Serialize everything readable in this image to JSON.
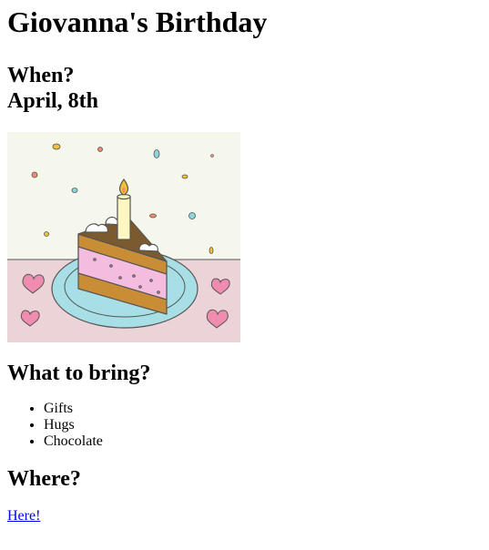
{
  "page": {
    "title": "Giovanna's Birthday",
    "when_heading": "When?",
    "when_date": "April, 8th",
    "image": {
      "subject": "birthday-cake-slice-icon",
      "colors": {
        "background": "#f5f6ec",
        "table": "#ecd3d8",
        "plate": "#a8dfe6",
        "cake_layer": "#c88d35",
        "frosting": "#f4bde0",
        "chocolate_top": "#7a5a2e",
        "candle": "#fdf8c2",
        "flame": "#f3c234",
        "heart": "#f08cb0"
      }
    },
    "bring_heading": "What to bring?",
    "bring_items": [
      "Gifts",
      "Hugs",
      "Chocolate"
    ],
    "where_heading": "Where?",
    "where_link": "Here!"
  },
  "theme": {
    "link_color": "#0000ee"
  }
}
